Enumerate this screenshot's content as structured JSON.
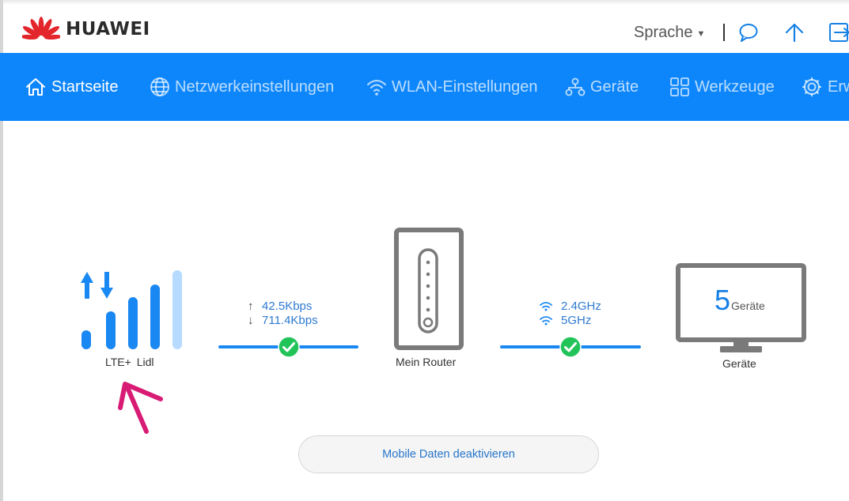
{
  "header": {
    "brand": "HUAWEI",
    "language_label": "Sprache",
    "icons": [
      "chat-icon",
      "upload-icon",
      "logout-icon"
    ]
  },
  "nav": {
    "items": [
      {
        "label": "Startseite",
        "icon": "home-icon",
        "active": true
      },
      {
        "label": "Netzwerkeinstellungen",
        "icon": "globe-icon",
        "active": false
      },
      {
        "label": "WLAN-Einstellungen",
        "icon": "wifi-icon",
        "active": false
      },
      {
        "label": "Geräte",
        "icon": "devices-icon",
        "active": false
      },
      {
        "label": "Werkzeuge",
        "icon": "tools-icon",
        "active": false
      },
      {
        "label": "Erw",
        "icon": "settings-icon",
        "active": false
      }
    ]
  },
  "network": {
    "label": "LTE+ Lidl",
    "signal_bars_filled": 4,
    "signal_bars_total": 5
  },
  "traffic": {
    "upload": "42.5Kbps",
    "download": "711.4Kbps"
  },
  "router": {
    "label": "Mein Router"
  },
  "wifi": {
    "band_1": "2.4GHz",
    "band_2": "5GHz"
  },
  "devices": {
    "count": "5",
    "count_unit": "Geräte",
    "label": "Geräte"
  },
  "actions": {
    "mobile_data": "Mobile Daten deaktivieren"
  },
  "colors": {
    "nav_blue": "#0e86fb",
    "accent_blue": "#1580e6",
    "status_green": "#22c45a",
    "annotation_pink": "#d81b74",
    "logo_red": "#e3262c"
  }
}
